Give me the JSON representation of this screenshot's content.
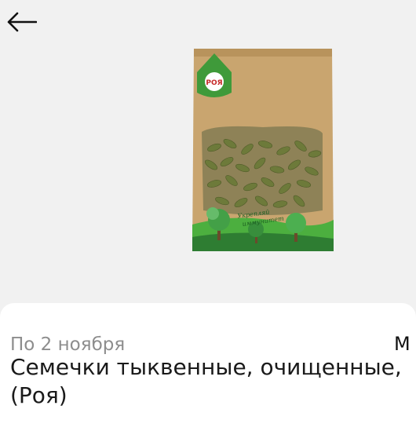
{
  "header": {
    "back_icon": "arrow-left-icon"
  },
  "product": {
    "image_icon": "pumpkin-seeds-package-image",
    "brand_logo": "Роя",
    "package_slogan": "Укрепляй иммунитет",
    "colors": {
      "kraft": "#c9a56f",
      "green": "#3f9a3a",
      "seeds": "#6d7a3a"
    }
  },
  "details": {
    "delivery": "По 2 ноября",
    "price_partial": "М",
    "title_line1": "Семечки тыквенные, очищенные,",
    "title_line2": "(Роя)"
  }
}
